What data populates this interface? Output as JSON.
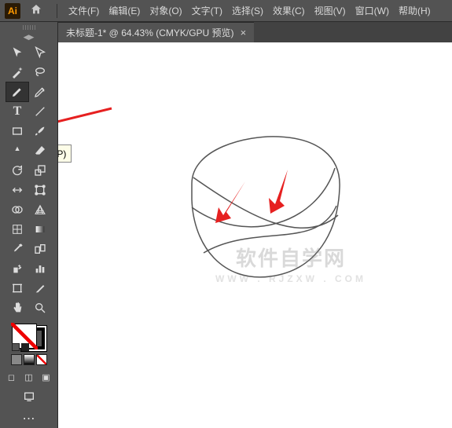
{
  "logo_text": "Ai",
  "menus": {
    "file": "文件(F)",
    "edit": "编辑(E)",
    "object": "对象(O)",
    "type": "文字(T)",
    "select": "选择(S)",
    "effect": "效果(C)",
    "view": "视图(V)",
    "window": "窗口(W)",
    "help": "帮助(H)"
  },
  "doc_tab": {
    "title": "未标题-1* @ 64.43%  (CMYK/GPU 预览)",
    "close": "×"
  },
  "tooltip": "钢笔工具 (P)",
  "watermark": {
    "main": "软件自学网",
    "sub": "WWW . RJZXW . COM"
  },
  "colors": {
    "accent": "#ff9a00",
    "arrow_red": "#e62020"
  }
}
